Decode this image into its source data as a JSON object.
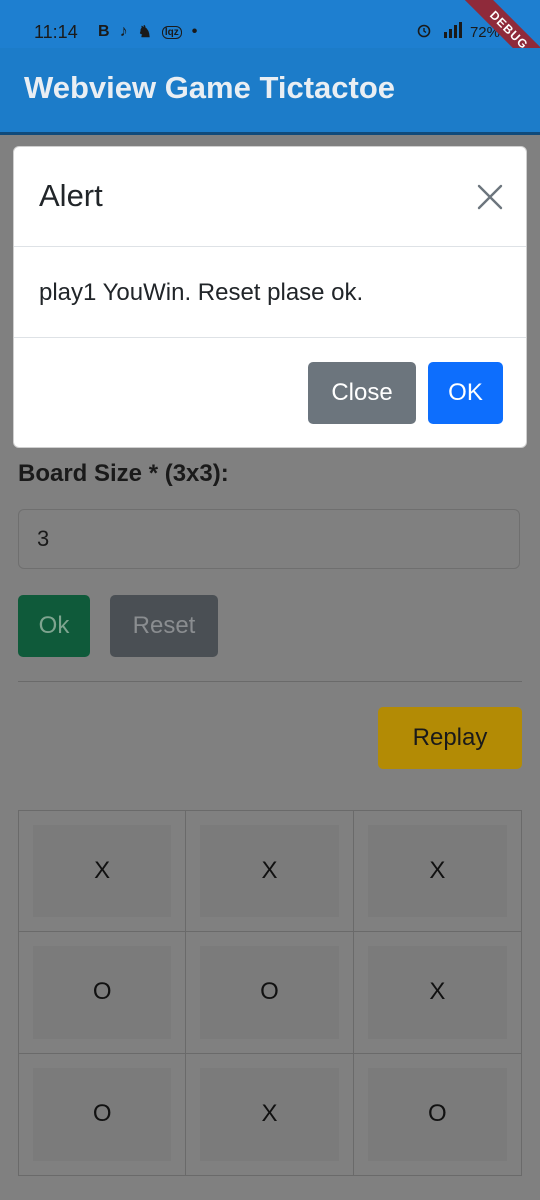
{
  "status_bar": {
    "time": "11:14",
    "notification_icons": [
      "B",
      "♪",
      "♞",
      "lqz",
      "•"
    ],
    "right_icons": [
      "alarm-icon",
      "signal-icon"
    ],
    "battery": "72%",
    "debug_label": "DEBUG"
  },
  "app_bar": {
    "title": "Webview Game Tictactoe"
  },
  "form": {
    "board_size_label": "Board Size * (3x3):",
    "board_size_value": "3",
    "ok_label": "Ok",
    "reset_label": "Reset",
    "replay_label": "Replay"
  },
  "board": {
    "cells": [
      "X",
      "X",
      "X",
      "O",
      "O",
      "X",
      "O",
      "X",
      "O"
    ]
  },
  "modal": {
    "title": "Alert",
    "message": "play1 YouWin. Reset plase ok.",
    "close_label": "Close",
    "ok_label": "OK"
  },
  "colors": {
    "app_bar": "#1c7cc9",
    "overlay_page": "#808080",
    "primary": "#0d6efd",
    "secondary": "#6c757d",
    "warning_dim": "#b38b05",
    "success_dim": "#0f5a3a"
  }
}
